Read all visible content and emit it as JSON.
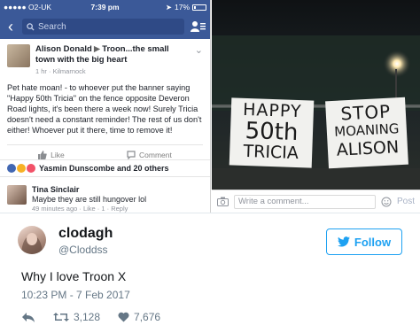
{
  "facebook": {
    "status_bar": {
      "carrier": "●●●●● O2-UK",
      "time": "7:39 pm",
      "battery": "17%"
    },
    "search": {
      "placeholder": "Search"
    },
    "post": {
      "author": "Alison Donald",
      "group": "Troon...the small town with the big heart",
      "meta": "1 hr · Kilmarnock",
      "text": "Pet hate moan! - to whoever put the banner saying \"Happy 50th Tricia\" on the fence opposite Deveron Road lights, it's been there a week now! Surely Tricia doesn't need a constant reminder! The rest of us don't either! Whoever  put it there, time to remove it!",
      "like_label": "Like",
      "comment_label": "Comment"
    },
    "reactions": {
      "text": "Yasmin Dunscombe and 20 others"
    },
    "comment": {
      "author": "Tina Sinclair",
      "text": "Maybe they are still hungover lol",
      "meta": "49 minutes ago · Like · 1 · Reply"
    }
  },
  "photo": {
    "banner_left": [
      "HAPPY",
      "50th",
      "TRICIA"
    ],
    "banner_right": [
      "STOP",
      "MOANING",
      "ALISON"
    ],
    "comment_placeholder": "Write a comment...",
    "post_label": "Post"
  },
  "tweet": {
    "name": "clodagh",
    "handle": "@Cloddss",
    "follow_label": "Follow",
    "text": "Why I love Troon X",
    "timestamp": "10:23 PM - 7 Feb 2017",
    "retweets": "3,128",
    "likes": "7,676",
    "accent": "#1da1f2"
  }
}
